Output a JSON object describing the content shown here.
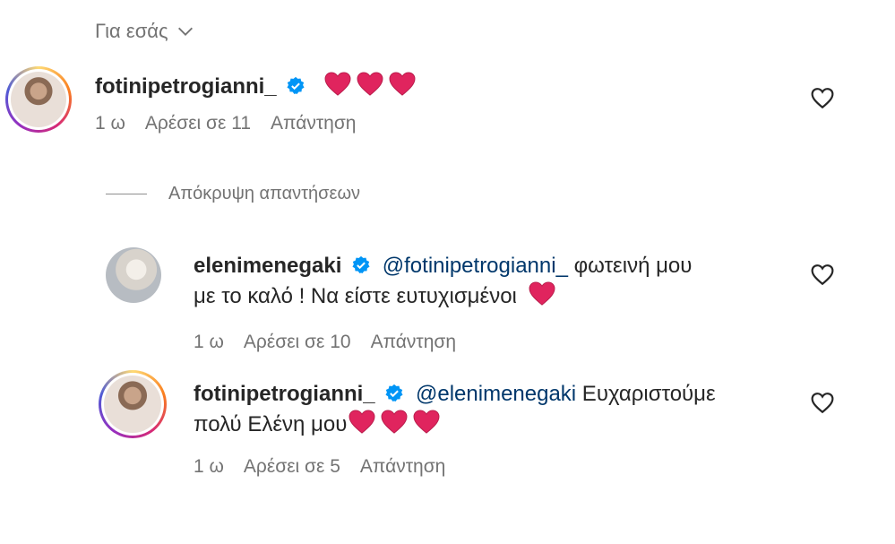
{
  "header": {
    "label": "Για εσάς",
    "icon": "chevron-down-icon"
  },
  "comments": [
    {
      "username": "fotinipetrogianni_",
      "text": "",
      "hearts": 3,
      "time": "1 ω",
      "likes": "Αρέσει σε 11",
      "reply": "Απάντηση"
    },
    {
      "username": "elenimenegaki",
      "mention": "@fotinipetrogianni_",
      "text_line1": " φωτεινή μου",
      "text_line2": "με το καλό ! Να είστε ευτυχισμένοι",
      "hearts": 1,
      "time": "1 ω",
      "likes": "Αρέσει σε 10",
      "reply": "Απάντηση"
    },
    {
      "username": "fotinipetrogianni_",
      "mention": "@elenimenegaki",
      "text_line1": " Ευχαριστούμε",
      "text_line2": "πολύ Ελένη μου",
      "hearts": 3,
      "time": "1 ω",
      "likes": "Αρέσει σε 5",
      "reply": "Απάντηση"
    }
  ],
  "hide_replies": "Απόκρυψη απαντήσεων",
  "colors": {
    "verified": "#0095f6",
    "heart": "#e0245e",
    "mention": "#00376b",
    "muted": "#737373"
  }
}
